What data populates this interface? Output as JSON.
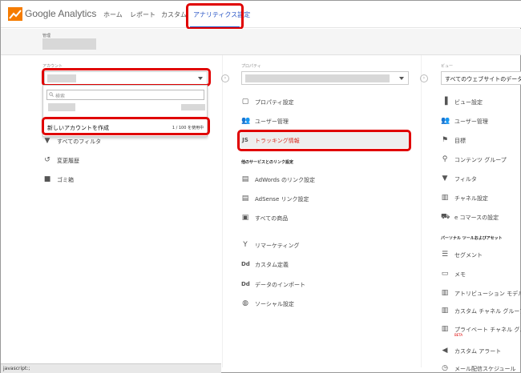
{
  "app": {
    "brand": "Google Analytics"
  },
  "nav": {
    "home": "ホーム",
    "report": "レポート",
    "custom": "カスタム",
    "admin": "アナリティクス設定"
  },
  "header": {
    "admin_label": "管理"
  },
  "account": {
    "label": "アカウント",
    "search_placeholder": "検索",
    "create_label": "新しいアカウントを作成",
    "usage": "1 / 100 を使用中",
    "items": [
      {
        "label": "すべてのフィルタ",
        "icon": "filter-icon"
      },
      {
        "label": "変更履歴",
        "icon": "history-icon"
      },
      {
        "label": "ゴミ箱",
        "icon": "trash-icon"
      }
    ]
  },
  "property": {
    "label": "プロパティ",
    "items": [
      {
        "label": "プロパティ設定",
        "icon": "settings-icon"
      },
      {
        "label": "ユーザー管理",
        "icon": "users-icon"
      },
      {
        "label": "トラッキング情報",
        "icon": "js-icon"
      }
    ],
    "linking_header": "他のサービスとのリンク設定",
    "linking": [
      {
        "label": "AdWords のリンク設定",
        "icon": "adwords-icon"
      },
      {
        "label": "AdSense リンク設定",
        "icon": "adsense-icon"
      },
      {
        "label": "すべての商品",
        "icon": "products-icon"
      }
    ],
    "more": [
      {
        "label": "リマーケティング",
        "icon": "remarketing-icon"
      },
      {
        "label": "カスタム定義",
        "icon": "dd-icon"
      },
      {
        "label": "データのインポート",
        "icon": "dd-icon"
      },
      {
        "label": "ソーシャル設定",
        "icon": "globe-icon"
      }
    ]
  },
  "view": {
    "label": "ビュー",
    "selected": "すべてのウェブサイトのデータ",
    "items": [
      {
        "label": "ビュー設定",
        "icon": "document-icon"
      },
      {
        "label": "ユーザー管理",
        "icon": "users-icon"
      },
      {
        "label": "目標",
        "icon": "flag-icon"
      },
      {
        "label": "コンテンツ グループ",
        "icon": "person-icon"
      },
      {
        "label": "フィルタ",
        "icon": "filter-icon"
      },
      {
        "label": "チャネル設定",
        "icon": "channel-icon"
      },
      {
        "label": "e コマースの設定",
        "icon": "cart-icon"
      }
    ],
    "personal_header": "パーソナル ツールおよびアセット",
    "personal": [
      {
        "label": "セグメント",
        "icon": "segment-icon"
      },
      {
        "label": "メモ",
        "icon": "memo-icon"
      },
      {
        "label": "アトリビューション モデル",
        "icon": "attribution-icon"
      },
      {
        "label": "カスタム チャネル グループ",
        "icon": "channel-icon"
      },
      {
        "label": "プライベート チャネル グルー",
        "icon": "channel-icon"
      },
      {
        "label": "カスタム アラート",
        "icon": "megaphone-icon"
      },
      {
        "label": "メール配信スケジュール",
        "icon": "clock-icon"
      }
    ],
    "beta": "BETA"
  },
  "status": {
    "text": "javascript:;"
  },
  "colors": {
    "accent": "#2a56c6",
    "highlight": "#e00000",
    "tracking": "#d93025"
  }
}
